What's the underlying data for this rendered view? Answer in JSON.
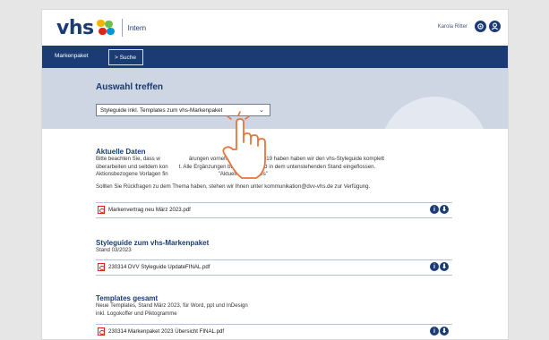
{
  "header": {
    "logo_text": "vhs",
    "logo_sub": "Intern",
    "user_name": "Karola Ritter",
    "icons": [
      "settings-icon",
      "user-icon"
    ]
  },
  "nav": {
    "root": "Markenpaket",
    "active": "> Suche"
  },
  "hero": {
    "title": "Auswahl treffen",
    "select_value": "Styleguide inkl. Templates zum vhs-Markenpaket"
  },
  "sections": [
    {
      "title": "Aktuelle Daten",
      "text_1": "Bitte beachten Sie, dass w",
      "text_1b": "ärungen vornehmen werden. 2019 haben haben wir den vhs-Styleguide komplett",
      "text_2": "überarbeiten und seitdem kon",
      "text_2b": "t. Alle Ergänzungen bis 03/2023 sind in dem untenstehenden Stand eingeflossen.",
      "text_3": "Aktionsbezogene Vorlagen fin",
      "text_3b": "\"Aktuelle Templates\"",
      "text_4": "Sollten Sie Rückfragen zu dem Thema haben, stehen wir Ihnen unter kommunikation@dvv-vhs.de zur Verfügung.",
      "file": "Markenvertrag neu März 2023.pdf"
    },
    {
      "title": "Styleguide zum vhs-Markenpaket",
      "text_1": "Stand 03/2023",
      "file": "230314 DVV Styleguide UpdateFINAL.pdf"
    },
    {
      "title": "Templates gesamt",
      "text_1": "Neue Templates, Stand März 2023, für Word, ppt und InDesign",
      "text_2": "inkl. Logokoffer und Piktogramme",
      "file": "230314 Markenpaket 2023 Übersicht FINAL.pdf"
    }
  ],
  "file_actions": {
    "info": "i",
    "download": "⬇"
  },
  "colors": {
    "brand": "#1a3b73",
    "hero_bg": "#cdd6e2",
    "pdf_red": "#d7261e",
    "hand_outline": "#e8743b"
  },
  "overlay": {
    "icon": "pointer-hand-icon"
  }
}
